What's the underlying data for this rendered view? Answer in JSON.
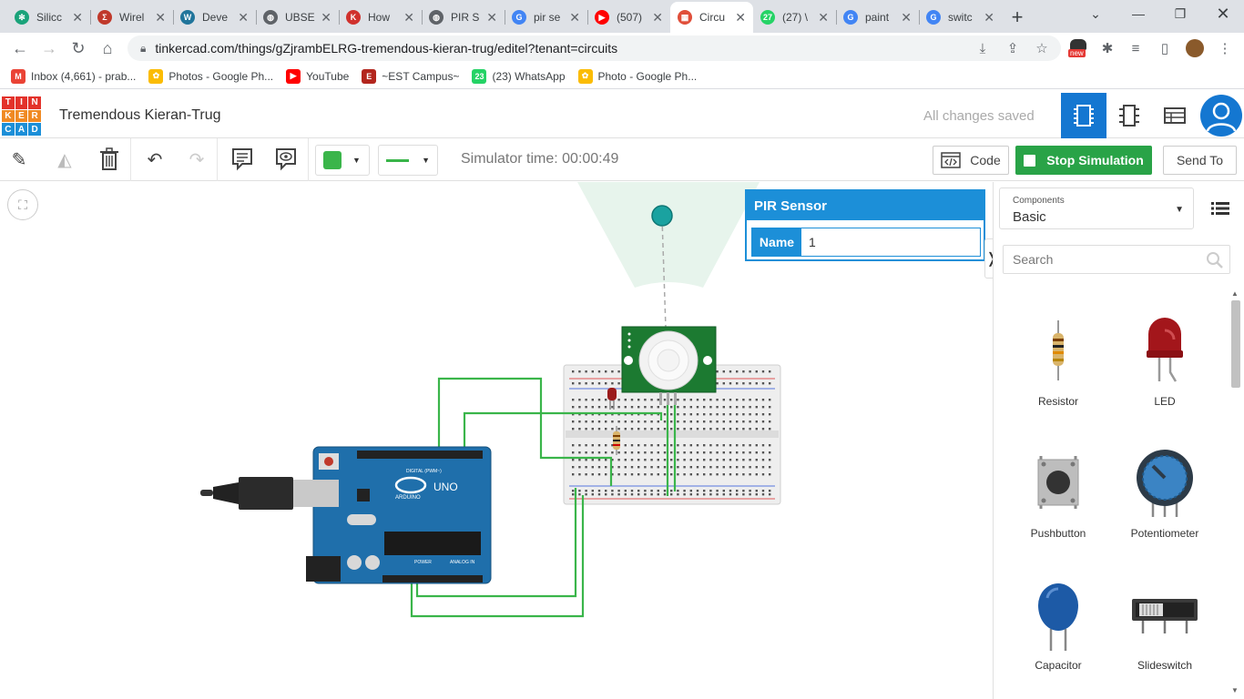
{
  "browser": {
    "tabs": [
      {
        "title": "Silicc",
        "color": "#1aa37a",
        "glyph": "✻"
      },
      {
        "title": "Wirel",
        "color": "#c0392b",
        "glyph": "Σ"
      },
      {
        "title": "Deve",
        "color": "#21759b",
        "glyph": "W"
      },
      {
        "title": "UBSE",
        "color": "#5f6368",
        "glyph": "◍"
      },
      {
        "title": "How",
        "color": "#d0312d",
        "glyph": "K"
      },
      {
        "title": "PIR S",
        "color": "#5f6368",
        "glyph": "◍"
      },
      {
        "title": "pir se",
        "color": "#4285f4",
        "glyph": "G"
      },
      {
        "title": "(507)",
        "color": "#ff0000",
        "glyph": "▶"
      },
      {
        "title": "Circu",
        "color": "#e04e39",
        "glyph": "▦",
        "active": true
      },
      {
        "title": "(27) \\",
        "color": "#25d366",
        "glyph": "27"
      },
      {
        "title": "paint",
        "color": "#4285f4",
        "glyph": "G"
      },
      {
        "title": "switc",
        "color": "#4285f4",
        "glyph": "G"
      }
    ],
    "url": "tinkercad.com/things/gZjrambELRG-tremendous-kieran-trug/editel?tenant=circuits",
    "new_badge": "new",
    "bookmarks": [
      {
        "label": "Inbox (4,661) - prab...",
        "color": "#ea4335",
        "glyph": "M"
      },
      {
        "label": "Photos - Google Ph...",
        "color": "#fbbc04",
        "glyph": "✿"
      },
      {
        "label": "YouTube",
        "color": "#ff0000",
        "glyph": "▶"
      },
      {
        "label": "~EST Campus~",
        "color": "#b3261e",
        "glyph": "E"
      },
      {
        "label": "(23) WhatsApp",
        "color": "#25d366",
        "glyph": "23"
      },
      {
        "label": "Photo - Google Ph...",
        "color": "#fbbc04",
        "glyph": "✿"
      }
    ]
  },
  "app": {
    "logo_letters": [
      "T",
      "I",
      "N",
      "K",
      "E",
      "R",
      "C",
      "A",
      "D"
    ],
    "project_title": "Tremendous Kieran-Trug",
    "save_status": "All changes saved",
    "simulator_time": "Simulator time: 00:00:49",
    "code_label": "Code",
    "stop_label": "Stop Simulation",
    "send_label": "Send To",
    "shape_color": "#3ab54a",
    "wire_color": "#3ab54a"
  },
  "inspector": {
    "title": "PIR Sensor",
    "name_label": "Name",
    "name_value": "1"
  },
  "components_panel": {
    "category_caption": "Components",
    "category_value": "Basic",
    "search_placeholder": "Search",
    "items": [
      {
        "label": "Resistor",
        "icon": "resistor-icon"
      },
      {
        "label": "LED",
        "icon": "led-icon"
      },
      {
        "label": "Pushbutton",
        "icon": "pushbutton-icon"
      },
      {
        "label": "Potentiometer",
        "icon": "potentiometer-icon"
      },
      {
        "label": "Capacitor",
        "icon": "capacitor-icon"
      },
      {
        "label": "Slideswitch",
        "icon": "slideswitch-icon"
      }
    ]
  },
  "circuit": {
    "board_label": "UNO",
    "board_brand": "ARDUINO",
    "board_digital_label": "DIGITAL (PWM~)",
    "board_power_label": "POWER",
    "board_analog_label": "ANALOG IN"
  }
}
